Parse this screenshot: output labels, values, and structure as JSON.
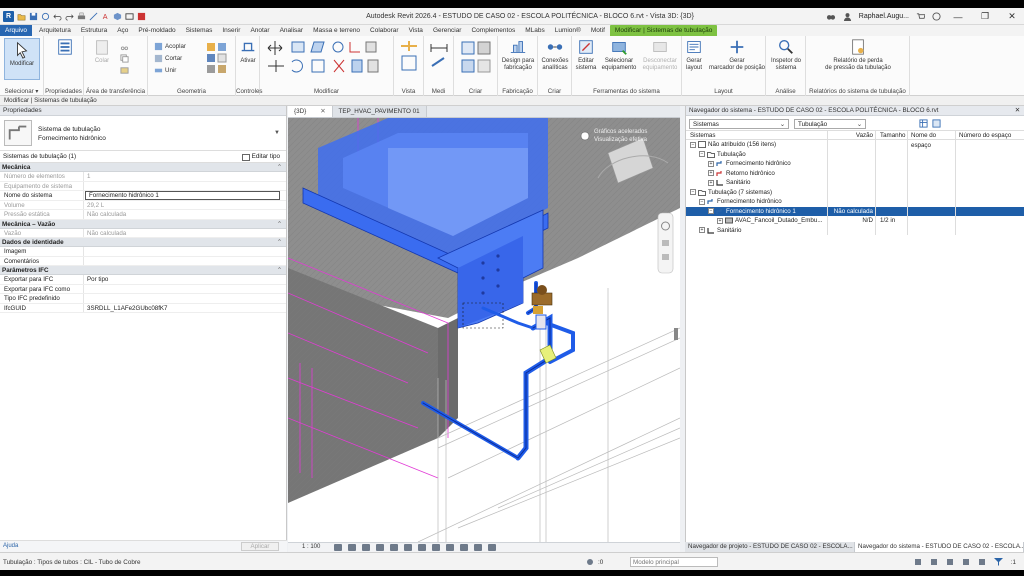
{
  "window": {
    "title": "Autodesk Revit 2026.4 - ESTUDO DE CASO 02 - ESCOLA POLITÉCNICA - BLOCO 6.rvt - Vista 3D: {3D}",
    "user": "Raphael.Augu...",
    "app_letter": "R"
  },
  "tabs": [
    "Arquivo",
    "Arquitetura",
    "Estrutura",
    "Aço",
    "Pré-moldado",
    "Sistemas",
    "Inserir",
    "Anotar",
    "Analisar",
    "Massa e terreno",
    "Colaborar",
    "Vista",
    "Gerenciar",
    "Complementos",
    "MLabs",
    "Lumion®",
    "Motif",
    "Modificar | Sistemas de tubulação"
  ],
  "ribbon": {
    "modify": "Modificar",
    "select_label": "Selecionar ▾",
    "properties_label": "Propriedades",
    "clipboard_label": "Área de transferência",
    "geometry_label": "Geometria",
    "controls_label": "Controles",
    "modify_label": "Modificar",
    "view_label": "Vista",
    "measure_label": "Medi",
    "create_label": "Criar",
    "fabrication_label": "Fabricação",
    "create2_label": "Criar",
    "systems_tools_label": "Ferramentas do sistema",
    "layout_label": "Layout",
    "analysis_label": "Análise",
    "reports_label": "Relatórios do sistema de tubulação",
    "cope": "Acoplar",
    "cut": "Cortar",
    "join": "Unir",
    "activate": "Ativar",
    "design_fab": "Design para\nfabricação",
    "connections": "Conexões\nanalíticas",
    "edit_system": "Editar\nsistema",
    "select_equipment": "Selecionar\nequipamento",
    "disconnect_equipment": "Desconectar\nequipamento",
    "gen_layout": "Gerar\nlayout",
    "gen_placeholder": "Gerar\nmarcador de posição",
    "inspector": "Inspetor do\nsistema",
    "pressure_report": "Relatório de perda\nde pressão da tubulação",
    "cell_label": "Célula",
    "paste_label": "Colar"
  },
  "options_bar": "Modificar | Sistemas de tubulação",
  "properties": {
    "header": "Propriedades",
    "type_line1": "Sistema de tubulação",
    "type_line2": "Fornecimento hidrônico",
    "instance": "Sistemas de tubulação (1)",
    "edit_type": "Editar tipo",
    "apply": "Aplicar",
    "help": "Ajuda",
    "groups": [
      {
        "name": "Mecânica",
        "rows": [
          {
            "k": "Número de elementos",
            "v": "1",
            "dim": true
          },
          {
            "k": "Equipamento de sistema",
            "v": "",
            "dim": true
          },
          {
            "k": "Nome do sistema",
            "v": "Fornecimento hidrônico 1",
            "dim": false,
            "boxed": true
          },
          {
            "k": "Volume",
            "v": "29,2 L",
            "dim": true
          },
          {
            "k": "Pressão estática",
            "v": "Não calculada",
            "dim": true
          }
        ]
      },
      {
        "name": "Mecânica – Vazão",
        "rows": [
          {
            "k": "Vazão",
            "v": "Não calculada",
            "dim": true
          }
        ]
      },
      {
        "name": "Dados de identidade",
        "rows": [
          {
            "k": "Imagem",
            "v": "",
            "dim": false
          },
          {
            "k": "Comentários",
            "v": "",
            "dim": false
          }
        ]
      },
      {
        "name": "Parâmetros IFC",
        "rows": [
          {
            "k": "Exportar para IFC",
            "v": "Por tipo",
            "dim": false
          },
          {
            "k": "Exportar para IFC como",
            "v": "",
            "dim": false
          },
          {
            "k": "Tipo IFC predefinido",
            "v": "",
            "dim": false
          },
          {
            "k": "IfcGUID",
            "v": "3SRDLL_L1AFe2GUbc08fK7",
            "dim": false
          }
        ]
      }
    ]
  },
  "viewport": {
    "tabs": [
      "{3D}",
      "TEP_HVAC_PAVIMENTO 01"
    ],
    "scale": "1 : 100",
    "overlay_line1": "Gráficos acelerados",
    "overlay_line2": "Visualização efetiva"
  },
  "system_browser": {
    "header": "Navegador do sistema - ESTUDO DE CASO 02 - ESCOLA POLITÉCNICA - BLOCO 6.rvt",
    "filter1": "Sistemas",
    "filter2": "Tubulação",
    "columns": [
      "Sistemas",
      "Vazão",
      "Tamanho",
      "Nome do espaço",
      "Número do espaço"
    ],
    "rows": [
      {
        "indent": 0,
        "expand": "−",
        "label": "Não atribuído (156 itens)",
        "vazao": "",
        "tamanho": "",
        "sel": false,
        "icon": "unassigned"
      },
      {
        "indent": 1,
        "expand": "−",
        "label": "Tubulação",
        "vazao": "",
        "tamanho": "",
        "sel": false,
        "icon": "folder"
      },
      {
        "indent": 2,
        "expand": "+",
        "label": "Fornecimento hidrônico",
        "vazao": "",
        "tamanho": "",
        "sel": false,
        "icon": "supply"
      },
      {
        "indent": 2,
        "expand": "+",
        "label": "Retorno hidrônico",
        "vazao": "",
        "tamanho": "",
        "sel": false,
        "icon": "return"
      },
      {
        "indent": 2,
        "expand": "+",
        "label": "Sanitário",
        "vazao": "",
        "tamanho": "",
        "sel": false,
        "icon": "sanitary"
      },
      {
        "indent": 0,
        "expand": "−",
        "label": "Tubulação (7 sistemas)",
        "vazao": "",
        "tamanho": "",
        "sel": false,
        "icon": "folder"
      },
      {
        "indent": 1,
        "expand": "−",
        "label": "Fornecimento hidrônico",
        "vazao": "",
        "tamanho": "",
        "sel": false,
        "icon": "supply"
      },
      {
        "indent": 2,
        "expand": "−",
        "label": "Fornecimento hidrônico 1",
        "vazao": "Não calculada",
        "tamanho": "",
        "sel": true,
        "icon": "supply"
      },
      {
        "indent": 3,
        "expand": "+",
        "label": "AVAC_Fancoil_Dutado_Embu...",
        "vazao": "N/D",
        "tamanho": "1/2 in",
        "sel": false,
        "icon": "equipment"
      },
      {
        "indent": 1,
        "expand": "+",
        "label": "Sanitário",
        "vazao": "",
        "tamanho": "",
        "sel": false,
        "icon": "sanitary"
      }
    ]
  },
  "bottom_tabs": [
    "Navegador de projeto - ESTUDO DE CASO 02 - ESCOLA...",
    "Navegador do sistema - ESTUDO DE CASO 02 - ESCOLA..."
  ],
  "status": {
    "text": "Tubulação : Tipos de tubos : CIL - Tubo de Cobre",
    "model": "Modelo principal",
    "zero": ":0",
    "filter": ":1"
  },
  "colors": {
    "accent": "#2867b2",
    "context_tab": "#7ec242",
    "pipe": "#1f5ce8",
    "selection": "#1e5ea8"
  }
}
